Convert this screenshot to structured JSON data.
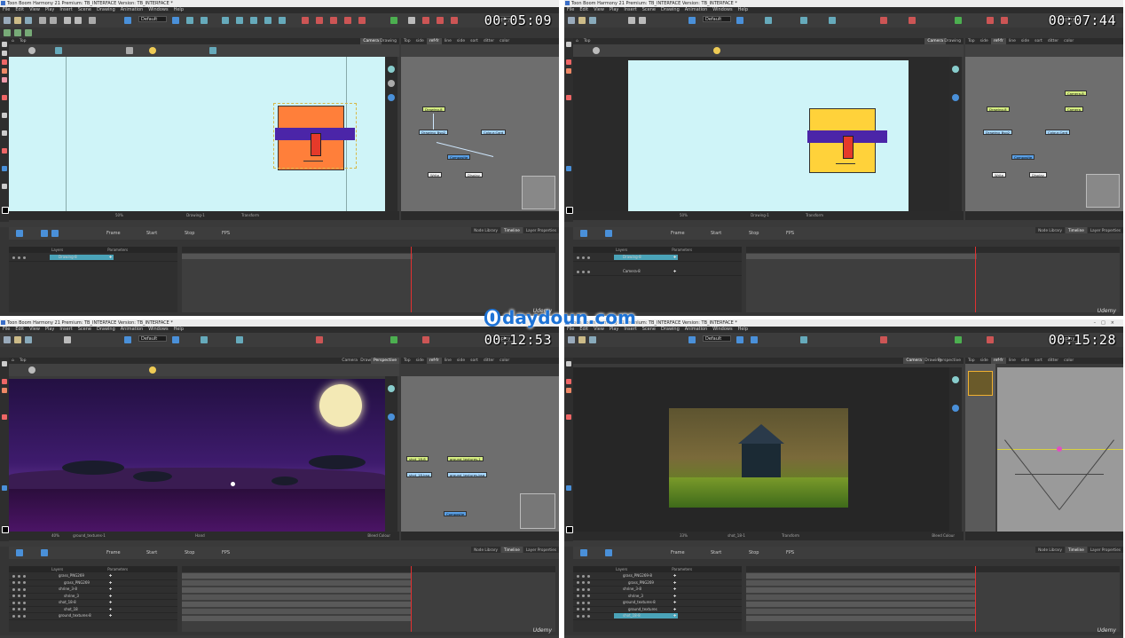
{
  "app_title": "Toon Boom Harmony 21 Premium: TB_INTERFACE Version: TB_INTERFACE *",
  "menu": [
    "File",
    "Edit",
    "View",
    "Play",
    "Insert",
    "Scene",
    "Drawing",
    "Animation",
    "Windows",
    "Help"
  ],
  "brand_watermark": "daydoun.com",
  "brand_glyph": "0",
  "corner_watermark": "Udemy",
  "toolbar": {
    "workspace_combo": "Default",
    "display_label": "Display"
  },
  "view_tabs": {
    "camera": "Camera",
    "drawing": "Drawing",
    "perspective": "Perspective"
  },
  "node_tabs": [
    "Top",
    "side",
    "ref-fr",
    "line",
    "side",
    "sort",
    "ditter",
    "color"
  ],
  "timeline_tabs": [
    "Node Library",
    "Timeline",
    "Layer Properties"
  ],
  "timeline_fields": {
    "frame": "Frame",
    "start": "Start",
    "stop": "Stop",
    "fps": "FPS"
  },
  "layers_header": {
    "layers": "Layers",
    "parameters": "Parameters"
  },
  "panes": [
    {
      "timecode": "00:05:09",
      "node_tabs_extra": "Top",
      "zoom": "50%",
      "layer_name": "Drawing-1",
      "status_mode": "Transform",
      "layers": [
        "Drawing-8"
      ],
      "nodes": {
        "drawing": "Drawing-8",
        "drawing2": "Drawing_Bsq2",
        "card": "Colour-Card",
        "composite": "Composite",
        "write": "Write",
        "display": "Display"
      },
      "fill_color": "#ff7f3a"
    },
    {
      "timecode": "00:07:44",
      "node_tabs_extra": "Top",
      "zoom": "50%",
      "layer_name": "Drawing-1",
      "status_mode": "Transform",
      "layers": [
        "Drawing-8",
        "Camera-8"
      ],
      "nodes": {
        "camera": "Camera-8",
        "camera2": "Camera",
        "drawing": "Drawing-8",
        "drawing2": "Drawing_Bsq2",
        "card": "Colour-Card",
        "composite": "Composite",
        "write": "Write",
        "display": "Display"
      },
      "fill_color": "#ffd23a"
    },
    {
      "timecode": "00:12:53",
      "node_tabs_extra": "Top",
      "zoom": "40%",
      "layer_name": "ground_textures-1",
      "status_mode": "Hand",
      "blend_label": "Bleed Colour",
      "layers": [
        "grass_PNG269",
        "grass_PNG269",
        "shrine_3-8",
        "shrine_3",
        "shot_18-8",
        "shot_18",
        "ground_textures-8"
      ],
      "nodes": {
        "a": "shot_18-8",
        "b": "ground_textures-1",
        "c": "shot_18-bsq",
        "d": "ground_textures-bsq",
        "composite": "Composite"
      }
    },
    {
      "timecode": "00:15:28",
      "node_tabs_extra": "Top",
      "zoom": "33%",
      "layer_name": "shot_18-1",
      "status_mode": "Transform",
      "blend_label": "Bleed Colour",
      "layers": [
        "grass_PNG269-8",
        "grass_PNG269",
        "shrine_3-8",
        "shrine_3",
        "ground_textures-8",
        "ground_textures",
        "shot_18-8"
      ]
    }
  ]
}
